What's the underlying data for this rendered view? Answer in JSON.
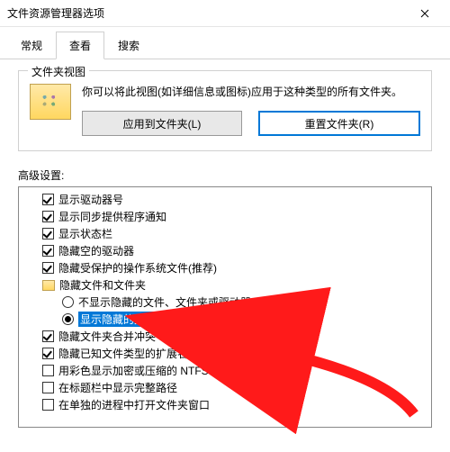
{
  "window": {
    "title": "文件资源管理器选项"
  },
  "tabs": {
    "general": "常规",
    "view": "查看",
    "search": "搜索",
    "active": "view"
  },
  "folderViews": {
    "legend": "文件夹视图",
    "description": "你可以将此视图(如详细信息或图标)应用于这种类型的所有文件夹。",
    "applyBtn": "应用到文件夹(L)",
    "resetBtn": "重置文件夹(R)"
  },
  "advanced": {
    "label": "高级设置:",
    "items": [
      {
        "type": "check",
        "indent": 1,
        "checked": true,
        "label": "显示驱动器号"
      },
      {
        "type": "check",
        "indent": 1,
        "checked": true,
        "label": "显示同步提供程序通知"
      },
      {
        "type": "check",
        "indent": 1,
        "checked": true,
        "label": "显示状态栏"
      },
      {
        "type": "check",
        "indent": 1,
        "checked": true,
        "label": "隐藏空的驱动器"
      },
      {
        "type": "check",
        "indent": 1,
        "checked": true,
        "label": "隐藏受保护的操作系统文件(推荐)"
      },
      {
        "type": "folder",
        "indent": 1,
        "label": "隐藏文件和文件夹"
      },
      {
        "type": "radio",
        "indent": 2,
        "selected": false,
        "label": "不显示隐藏的文件、文件夹或驱动器"
      },
      {
        "type": "radio",
        "indent": 2,
        "selected": true,
        "label": "显示隐藏的文件、文件夹和驱动器",
        "highlighted": true
      },
      {
        "type": "check",
        "indent": 1,
        "checked": true,
        "label": "隐藏文件夹合并冲突"
      },
      {
        "type": "check",
        "indent": 1,
        "checked": true,
        "label": "隐藏已知文件类型的扩展名"
      },
      {
        "type": "check",
        "indent": 1,
        "checked": false,
        "label": "用彩色显示加密或压缩的 NTFS 文件"
      },
      {
        "type": "check",
        "indent": 1,
        "checked": false,
        "label": "在标题栏中显示完整路径"
      },
      {
        "type": "check",
        "indent": 1,
        "checked": false,
        "label": "在单独的进程中打开文件夹窗口"
      }
    ]
  }
}
